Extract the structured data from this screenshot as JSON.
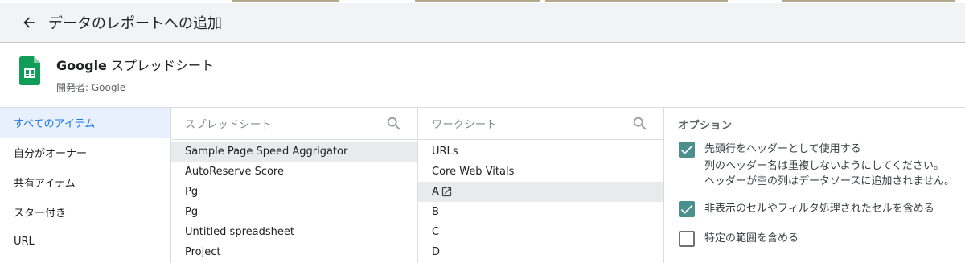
{
  "header": {
    "title": "データのレポートへの追加",
    "back_icon": "arrow-left-icon"
  },
  "connector": {
    "name_brand": "Google",
    "name_rest": " スプレッドシート",
    "developer": "開発者: Google",
    "icon": "google-sheets-icon",
    "icon_color": "#0f9d58"
  },
  "nav": {
    "items": [
      {
        "label": "すべてのアイテム",
        "active": true
      },
      {
        "label": "自分がオーナー"
      },
      {
        "label": "共有アイテム"
      },
      {
        "label": "スター付き"
      },
      {
        "label": "URL"
      }
    ]
  },
  "spreadsheets": {
    "header": "スプレッドシート",
    "items": [
      {
        "label": "Sample Page Speed Aggrigator",
        "selected": true
      },
      {
        "label": "AutoReserve Score"
      },
      {
        "label": "Pg"
      },
      {
        "label": "Pg"
      },
      {
        "label": "Untitled spreadsheet"
      },
      {
        "label": "Project"
      }
    ]
  },
  "worksheets": {
    "header": "ワークシート",
    "items": [
      {
        "label": "URLs"
      },
      {
        "label": "Core Web Vitals"
      },
      {
        "label": "A",
        "selected": true,
        "icon": "open-in-new-icon"
      },
      {
        "label": "B"
      },
      {
        "label": "C"
      },
      {
        "label": "D"
      }
    ]
  },
  "options": {
    "header": "オプション",
    "header_row": {
      "label": "先頭行をヘッダーとして使用する",
      "note1": "列のヘッダー名は重複しないようにしてください。",
      "note2": "ヘッダーが空の列はデータソースに追加されません。",
      "checked": true
    },
    "hidden": {
      "label": "非表示のセルやフィルタ処理されたセルを含める",
      "checked": true
    },
    "range": {
      "label": "特定の範囲を含める",
      "checked": false
    }
  },
  "colors": {
    "accent": "#1a73e8",
    "checkbox": "#4a918e",
    "header_bg": "#f1f3f4"
  }
}
